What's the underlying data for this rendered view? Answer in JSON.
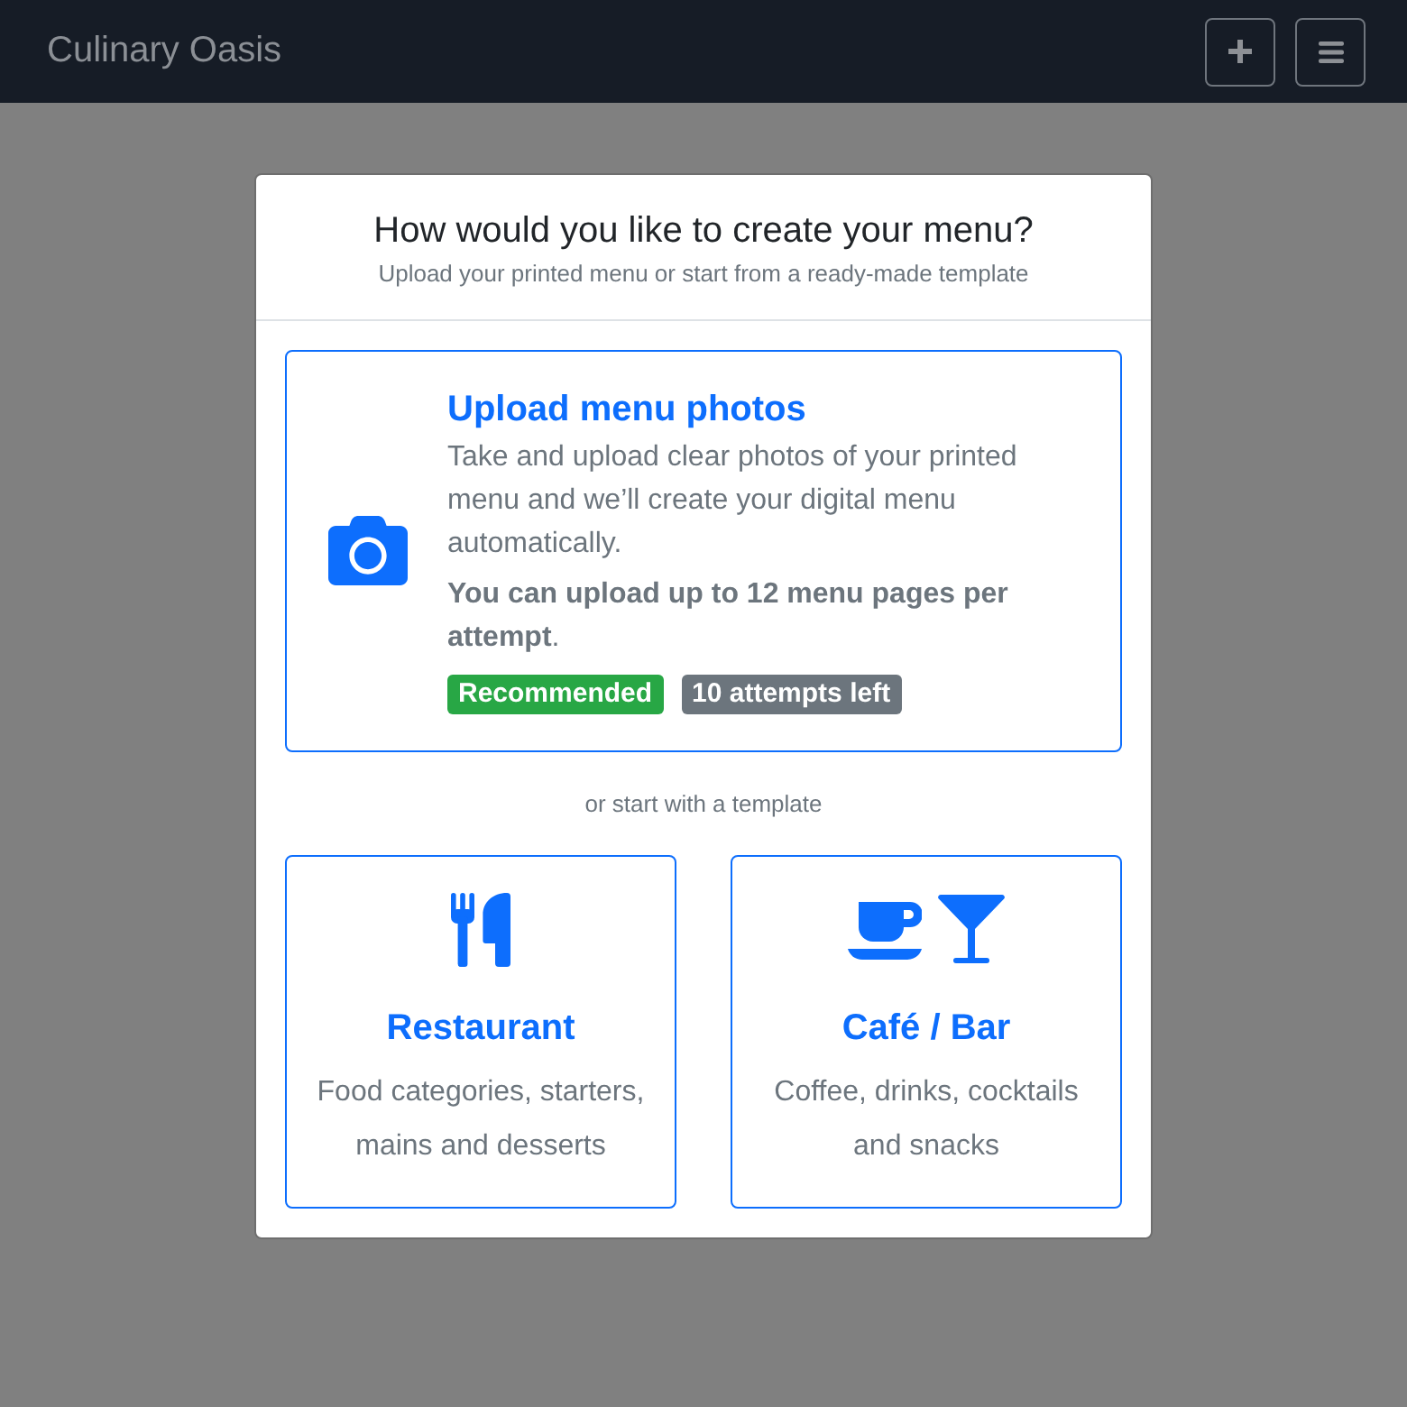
{
  "navbar": {
    "brand": "Culinary Oasis"
  },
  "modal": {
    "title": "How would you like to create your menu?",
    "subtitle": "Upload your printed menu or start from a ready-made template",
    "upload_option": {
      "title": "Upload menu photos",
      "description": "Take and upload clear photos of your printed menu and we’ll create your digital menu automatically.",
      "note": "**You can upload up to 12 menu pages per attempt**.",
      "badges": [
        {
          "label": "Recommended",
          "color": "#28a745"
        },
        {
          "label": "10 attempts left",
          "color": "#6c757d"
        }
      ]
    },
    "divider_text": "or start with a template",
    "templates": [
      {
        "title": "Restaurant",
        "description": "Food categories, starters, mains and desserts"
      },
      {
        "title": "Café / Bar",
        "description": "Coffee, drinks, cocktails and snacks"
      }
    ]
  }
}
